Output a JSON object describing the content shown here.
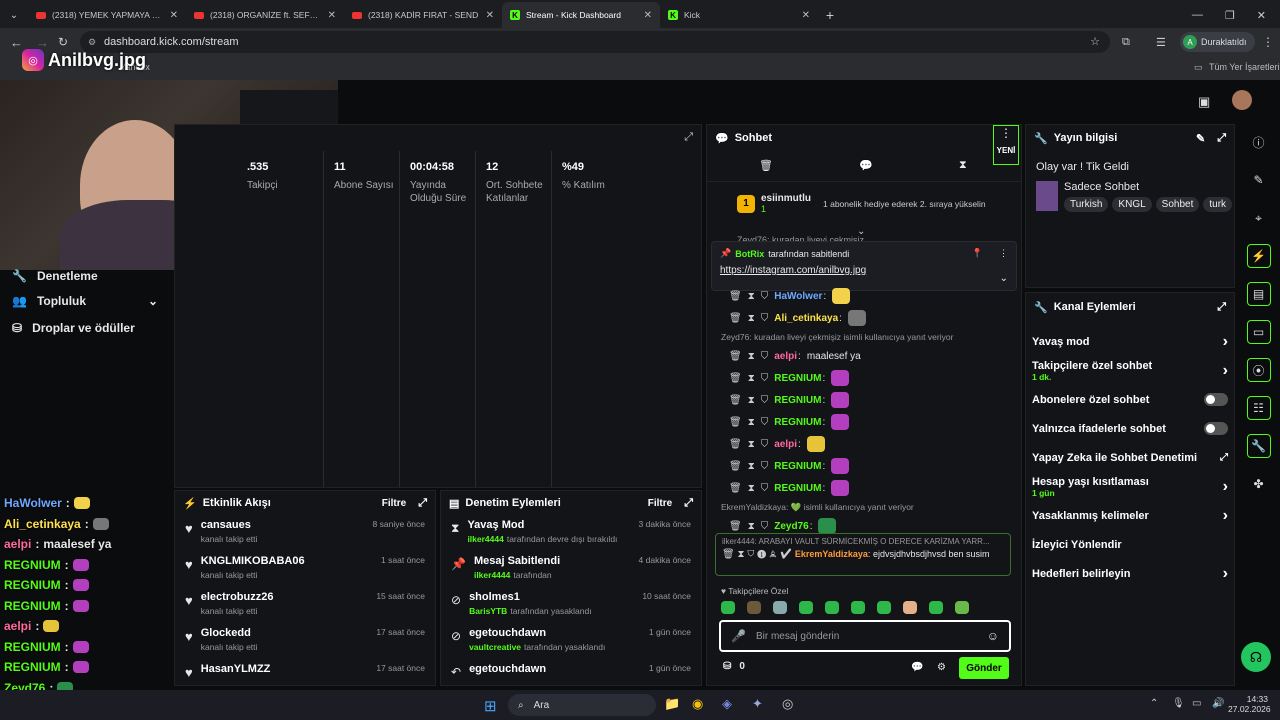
{
  "browser": {
    "tabs": [
      {
        "label": "(2318) YEMEK YAPMAYA GELDİ",
        "icon": "youtube-icon"
      },
      {
        "label": "(2318) ORGANİZE ft. SEFO - Ra",
        "icon": "youtube-icon"
      },
      {
        "label": "(2318) KADİR FIRAT - SEND",
        "icon": "youtube-icon"
      },
      {
        "label": "Stream - Kick Dashboard",
        "icon": "kick-icon"
      },
      {
        "label": "Kick",
        "icon": "kick-icon"
      }
    ],
    "url": "dashboard.kick.com/stream",
    "profile_label": "Duraklatıldı",
    "profile_initial": "A",
    "bookmark_yandex": "Yandex",
    "bookmarks_all": "Tüm Yer İşaretleri"
  },
  "overlay": {
    "channel_handle": "Anilbvg.jpg"
  },
  "left_nav": [
    {
      "label": "Denetleme"
    },
    {
      "label": "Topluluk"
    },
    {
      "label": "Droplar ve ödüller"
    }
  ],
  "stats": [
    {
      "value": ".535",
      "label": "Takipçi"
    },
    {
      "value": "11",
      "label": "Abone Sayısı"
    },
    {
      "value": "00:04:58",
      "label": "Yayında Olduğu Süre"
    },
    {
      "value": "12",
      "label": "Ort. Sohbete Katılanlar"
    },
    {
      "value": "%49",
      "label": "% Katılım"
    }
  ],
  "activity": {
    "title": "Etkinlik Akışı",
    "filter": "Filtre",
    "items": [
      {
        "name": "cansaues",
        "sub": "kanalı takip etti",
        "time": "8 saniye önce"
      },
      {
        "name": "KNGLMIKOBABA06",
        "sub": "kanalı takip etti",
        "time": "1 saat önce"
      },
      {
        "name": "electrobuzz26",
        "sub": "kanalı takip etti",
        "time": "15 saat önce"
      },
      {
        "name": "Glockedd",
        "sub": "kanalı takip etti",
        "time": "17 saat önce"
      },
      {
        "name": "HasanYLMZZ",
        "sub": "",
        "time": "17 saat önce"
      }
    ]
  },
  "moderation": {
    "title": "Denetim Eylemleri",
    "filter": "Filtre",
    "items": [
      {
        "name": "Yavaş Mod",
        "user": "ilker4444",
        "sub": "tarafından devre dışı bırakıldı",
        "time": "3 dakika önce"
      },
      {
        "name": "Mesaj Sabitlendi",
        "user": "ilker4444",
        "sub": "tarafından",
        "time": "4 dakika önce"
      },
      {
        "name": "sholmes1",
        "user": "BarisYTB",
        "sub": "tarafından yasaklandı",
        "time": "10 saat önce"
      },
      {
        "name": "egetouchdawn",
        "user": "vaultcreative",
        "sub": "tarafından yasaklandı",
        "time": "1 gün önce"
      },
      {
        "name": "egetouchdawn",
        "user": "",
        "sub": "",
        "time": "1 gün önce"
      }
    ]
  },
  "chat": {
    "title": "Sohbet",
    "new_badge": "YENİ",
    "gift_user": "esiinmutlu",
    "gift_count": "1",
    "gift_text": "1 abonelik hediye ederek 2. sıraya yükselin",
    "pinned_by": "BotRix",
    "pinned_suffix": "tarafından sabitlendi",
    "pinned_link": "https://instagram.com/anilbvg.jpg",
    "partial_line": "Zeyd76: kuradan liveyi çekmişiz",
    "messages": [
      {
        "user": "HaWolwer",
        "text": "",
        "color": "#6fa8ff"
      },
      {
        "user": "Ali_cetinkaya",
        "text": "",
        "color": "#ffe14d"
      },
      {
        "reply": "Zeyd76: kuradan liveyi çekmişiz isimli kullanıcıya yanıt veriyor"
      },
      {
        "user": "aelpi",
        "text": "maalesef ya",
        "color": "#ff6b9a"
      },
      {
        "user": "REGNIUM",
        "text": "",
        "color": "#53fc18"
      },
      {
        "user": "REGNIUM",
        "text": "",
        "color": "#53fc18"
      },
      {
        "user": "REGNIUM",
        "text": "",
        "color": "#53fc18"
      },
      {
        "user": "aelpi",
        "text": "",
        "color": "#ff6b9a"
      },
      {
        "user": "REGNIUM",
        "text": "",
        "color": "#53fc18"
      },
      {
        "user": "REGNIUM",
        "text": "",
        "color": "#53fc18"
      },
      {
        "reply": "EkremYaldizkaya: 💚 isimli kullanıcıya yanıt veriyor"
      },
      {
        "user": "Zeyd76",
        "text": "",
        "color": "#53fc18"
      }
    ],
    "highlight_reply": "ilker4444: ARABAYI VAULT SÜRMİCEKMİŞ O DERECE KARİZMA YARR...",
    "highlight_user": "EkremYaldizkaya",
    "highlight_text": "ejdvsjdhvbsdjhvsd ben susim",
    "followers_only": "Takipçilere Özel",
    "input_placeholder": "Bir mesaj gönderin",
    "points": "0",
    "send": "Gönder"
  },
  "stream_info": {
    "title": "Yayın bilgisi",
    "stream_title": "Olay var ! Tik Geldi",
    "category": "Sadece Sohbet",
    "tags": [
      "Turkish",
      "KNGL",
      "Sohbet",
      "turk"
    ]
  },
  "channel_actions": {
    "title": "Kanal Eylemleri",
    "items": [
      {
        "label": "Yavaş mod",
        "sub": "",
        "control": "arrow"
      },
      {
        "label": "Takipçilere özel sohbet",
        "sub": "1 dk.",
        "control": "arrow"
      },
      {
        "label": "Abonelere özel sohbet",
        "sub": "",
        "control": "toggle"
      },
      {
        "label": "Yalnızca ifadelerle sohbet",
        "sub": "",
        "control": "toggle"
      },
      {
        "label": "Yapay Zeka ile Sohbet Denetimi",
        "sub": "",
        "control": "external"
      },
      {
        "label": "Hesap yaşı kısıtlaması",
        "sub": "1 gün",
        "control": "arrow"
      },
      {
        "label": "Yasaklanmış kelimeler",
        "sub": "",
        "control": "arrow"
      },
      {
        "label": "İzleyici Yönlendir",
        "sub": "",
        "control": "none"
      },
      {
        "label": "Hedefleri belirleyin",
        "sub": "",
        "control": "arrow"
      }
    ]
  },
  "overlay_chat": [
    {
      "user": "HaWolwer",
      "text": "",
      "color": "#6fa8ff"
    },
    {
      "user": "Ali_cetinkaya",
      "text": "",
      "color": "#ffe14d"
    },
    {
      "user": "aelpi",
      "text": "maalesef ya",
      "color": "#ff6b9a"
    },
    {
      "user": "REGNIUM",
      "text": "",
      "color": "#53fc18"
    },
    {
      "user": "REGNIUM",
      "text": "",
      "color": "#53fc18"
    },
    {
      "user": "REGNIUM",
      "text": "",
      "color": "#53fc18"
    },
    {
      "user": "aelpi",
      "text": "",
      "color": "#ff6b9a"
    },
    {
      "user": "REGNIUM",
      "text": "",
      "color": "#53fc18"
    },
    {
      "user": "REGNIUM",
      "text": "",
      "color": "#53fc18"
    },
    {
      "user": "Zeyd76",
      "text": "",
      "color": "#53fc18"
    },
    {
      "user": "EkremYaldizkaya",
      "text": "ejdvsjdhvbsdjhvsd ben susim",
      "color": "#ff9c3a"
    }
  ],
  "taskbar": {
    "search": "Ara",
    "time": "14:33",
    "date": "27.02.2026"
  },
  "colors": {
    "accent": "#53fc18",
    "bg": "#0b0c0e",
    "panel": "#131418"
  }
}
